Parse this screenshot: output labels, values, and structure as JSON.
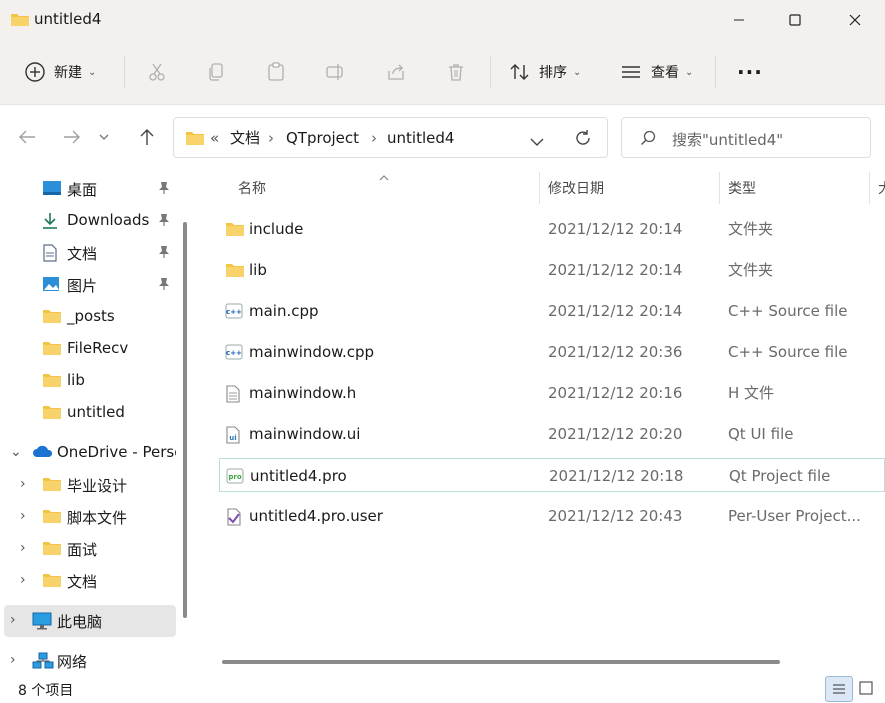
{
  "window": {
    "title": "untitled4"
  },
  "toolbar": {
    "new_label": "新建",
    "sort_label": "排序",
    "view_label": "查看",
    "more_label": "···"
  },
  "nav": {
    "breadcrumb": [
      "«",
      "文档",
      "QTproject",
      "untitled4"
    ],
    "search_placeholder": "搜索\"untitled4\""
  },
  "sidebar": {
    "items": [
      {
        "label": "桌面",
        "icon": "desktop-icon",
        "pinned": true
      },
      {
        "label": "Downloads",
        "icon": "download-icon",
        "pinned": true
      },
      {
        "label": "文档",
        "icon": "document-icon",
        "pinned": true
      },
      {
        "label": "图片",
        "icon": "picture-icon",
        "pinned": true
      },
      {
        "label": "_posts",
        "icon": "folder-icon"
      },
      {
        "label": "FileRecv",
        "icon": "folder-icon"
      },
      {
        "label": "lib",
        "icon": "folder-icon"
      },
      {
        "label": "untitled",
        "icon": "folder-icon"
      },
      {
        "label": "OneDrive - Perso",
        "icon": "cloud-icon"
      },
      {
        "label": "毕业设计",
        "icon": "folder-icon"
      },
      {
        "label": "脚本文件",
        "icon": "folder-icon"
      },
      {
        "label": "面试",
        "icon": "folder-icon"
      },
      {
        "label": "文档",
        "icon": "folder-icon"
      },
      {
        "label": "此电脑",
        "icon": "computer-icon",
        "selected": true
      },
      {
        "label": "网络",
        "icon": "network-icon"
      }
    ]
  },
  "columns": {
    "name": "名称",
    "date": "修改日期",
    "type": "类型",
    "size": "大"
  },
  "files": [
    {
      "name": "include",
      "date": "2021/12/12 20:14",
      "type": "文件夹",
      "icon": "folder-icon"
    },
    {
      "name": "lib",
      "date": "2021/12/12 20:14",
      "type": "文件夹",
      "icon": "folder-icon"
    },
    {
      "name": "main.cpp",
      "date": "2021/12/12 20:14",
      "type": "C++ Source file",
      "icon": "cpp-file-icon"
    },
    {
      "name": "mainwindow.cpp",
      "date": "2021/12/12 20:36",
      "type": "C++ Source file",
      "icon": "cpp-file-icon"
    },
    {
      "name": "mainwindow.h",
      "date": "2021/12/12 20:16",
      "type": "H 文件",
      "icon": "header-file-icon"
    },
    {
      "name": "mainwindow.ui",
      "date": "2021/12/12 20:20",
      "type": "Qt UI file",
      "icon": "ui-file-icon"
    },
    {
      "name": "untitled4.pro",
      "date": "2021/12/12 20:18",
      "type": "Qt Project file",
      "icon": "pro-file-icon",
      "selected": true
    },
    {
      "name": "untitled4.pro.user",
      "date": "2021/12/12 20:43",
      "type": "Per-User Project...",
      "icon": "user-file-icon"
    }
  ],
  "status": {
    "count_text": "8 个项目"
  },
  "colors": {
    "titlebar": "#f3f0ee",
    "folder": "#f4c542",
    "accent": "#0067c0",
    "selected_row_border": "#b8e0d4",
    "selected_side": "#e6e6e6"
  }
}
